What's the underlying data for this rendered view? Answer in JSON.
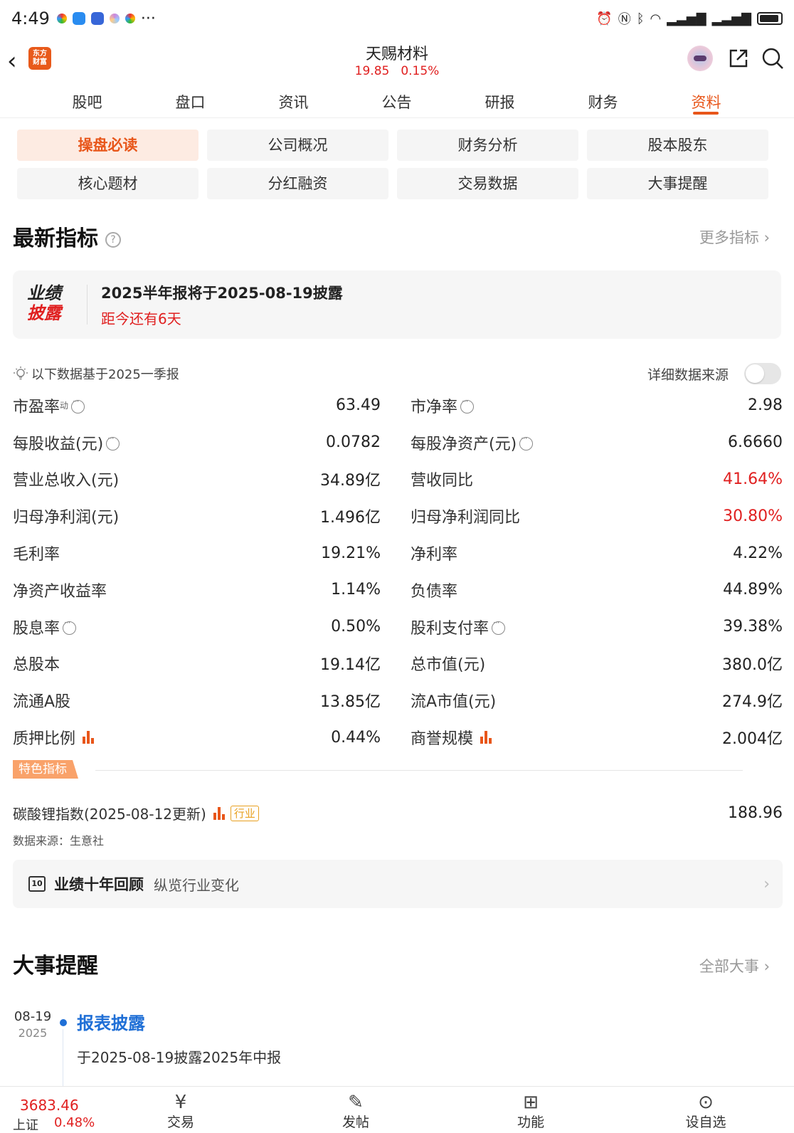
{
  "status_bar": {
    "time": "4:49",
    "more": "···"
  },
  "header": {
    "title": "天赐材料",
    "price": "19.85",
    "change": "0.15%",
    "logo_text_1": "东方",
    "logo_text_2": "财富"
  },
  "tabs": [
    "股吧",
    "盘口",
    "资讯",
    "公告",
    "研报",
    "财务",
    "资料"
  ],
  "active_tab": "资料",
  "grid_buttons": [
    "操盘必读",
    "公司概况",
    "财务分析",
    "股本股东",
    "核心题材",
    "分红融资",
    "交易数据",
    "大事提醒"
  ],
  "indicators": {
    "title": "最新指标",
    "help": "?",
    "more": "更多指标 ›",
    "disclosure": {
      "logo_line1": "业绩",
      "logo_line2": "披露",
      "title": "2025半年报将于2025-08-19披露",
      "countdown": "距今还有6天"
    },
    "basis": "以下数据基于2025一季报",
    "source_toggle_label": "详细数据来源",
    "rows": [
      {
        "l_label": "市盈率",
        "l_sup": "动",
        "l_value": "63.49",
        "r_label": "市净率",
        "r_value": "2.98"
      },
      {
        "l_label": "每股收益(元)",
        "l_value": "0.0782",
        "r_label": "每股净资产(元)",
        "r_value": "6.6660"
      },
      {
        "l_label": "营业总收入(元)",
        "l_value": "34.89亿",
        "r_label": "营收同比",
        "r_value": "41.64%"
      },
      {
        "l_label": "归母净利润(元)",
        "l_value": "1.496亿",
        "r_label": "归母净利润同比",
        "r_value": "30.80%"
      },
      {
        "l_label": "毛利率",
        "l_value": "19.21%",
        "r_label": "净利率",
        "r_value": "4.22%"
      },
      {
        "l_label": "净资产收益率",
        "l_value": "1.14%",
        "r_label": "负债率",
        "r_value": "44.89%"
      },
      {
        "l_label": "股息率",
        "l_value": "0.50%",
        "r_label": "股利支付率",
        "r_value": "39.38%"
      },
      {
        "l_label": "总股本",
        "l_value": "19.14亿",
        "r_label": "总市值(元)",
        "r_value": "380.0亿"
      },
      {
        "l_label": "流通A股",
        "l_value": "13.85亿",
        "r_label": "流A市值(元)",
        "r_value": "274.9亿"
      },
      {
        "l_label": "质押比例",
        "l_value": "0.44%",
        "r_label": "商誉规模",
        "r_value": "2.004亿"
      }
    ]
  },
  "special": {
    "tag": "特色指标",
    "lithium_label": "碳酸锂指数(2025-08-12更新)",
    "industry_tag": "行业",
    "lithium_value": "188.96",
    "data_source": "数据来源：生意社"
  },
  "review": {
    "icon_text": "10",
    "title": "业绩十年回顾",
    "subtitle": "纵览行业变化"
  },
  "events": {
    "title": "大事提醒",
    "more": "全部大事 ›",
    "items": [
      {
        "date": "08-19",
        "year": "2025",
        "title": "报表披露",
        "desc": "于2025-08-19披露2025年中报"
      }
    ]
  },
  "bottom_bar": {
    "index_value": "3683.46",
    "index_name": "上证",
    "index_change": "0.48%",
    "nav": [
      "交易",
      "发帖",
      "功能",
      "设自选"
    ]
  },
  "colors": {
    "accent": "#e8561a",
    "up_red": "#e02020",
    "link_blue": "#1f6fd6"
  }
}
